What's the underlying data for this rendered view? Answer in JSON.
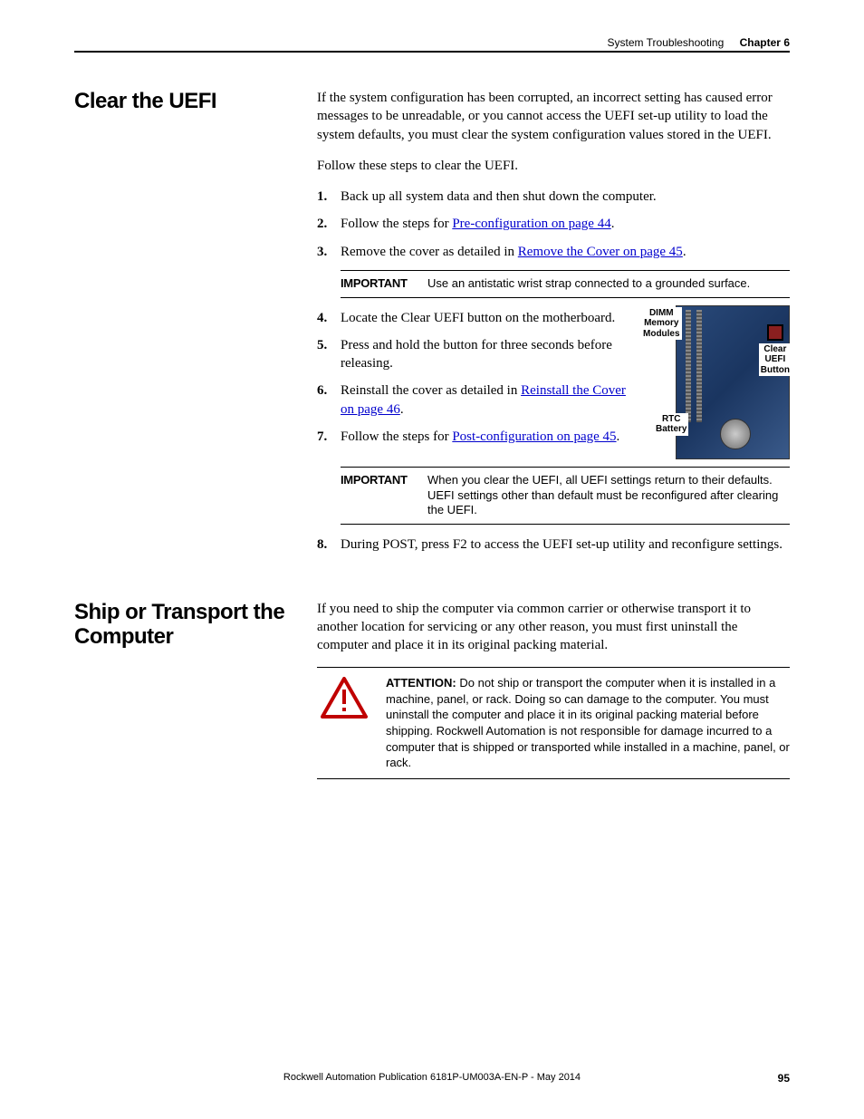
{
  "header": {
    "section": "System Troubleshooting",
    "chapter": "Chapter 6"
  },
  "sections": {
    "uefi": {
      "title": "Clear the UEFI",
      "intro": "If the system configuration has been corrupted, an incorrect setting has caused error messages to be unreadable, or you cannot access the UEFI set-up utility to load the system defaults, you must clear the system configuration values stored in the UEFI.",
      "follow": "Follow these steps to clear the UEFI.",
      "steps": {
        "s1": "Back up all system data and then shut down the computer.",
        "s2a": "Follow the steps for ",
        "s2link": "Pre-configuration on page 44",
        "s2b": ".",
        "s3a": "Remove the cover as detailed in ",
        "s3link": "Remove the Cover on page 45",
        "s3b": ".",
        "s4": "Locate the Clear UEFI button on the motherboard.",
        "s5": "Press and hold the button for three seconds before releasing.",
        "s6a": "Reinstall the cover as detailed in ",
        "s6link": "Reinstall the Cover on page 46",
        "s6b": ".",
        "s7a": "Follow the steps for ",
        "s7link": "Post-configuration on page 45",
        "s7b": ".",
        "s8": "During POST, press F2 to access the UEFI set-up utility and reconfigure settings."
      },
      "important1": {
        "label": "IMPORTANT",
        "text": "Use an antistatic wrist strap connected to a grounded surface."
      },
      "important2": {
        "label": "IMPORTANT",
        "text": "When you clear the UEFI, all UEFI settings return to their defaults. UEFI settings other than default must be reconfigured after clearing the UEFI."
      },
      "figure_labels": {
        "dimm": "DIMM\nMemory\nModules",
        "clear": "Clear\nUEFI\nButton",
        "rtc": "RTC\nBattery"
      }
    },
    "ship": {
      "title": "Ship or Transport the Computer",
      "intro": "If you need to ship the computer via common carrier or otherwise transport it to another location for servicing or any other reason, you must first uninstall the computer and place it in its original packing material.",
      "attention": {
        "label": "ATTENTION:",
        "text": " Do not ship or transport the computer when it is installed in a machine, panel, or rack. Doing so can damage to the computer. You must uninstall the computer and place it in its original packing material before shipping. Rockwell Automation is not responsible for damage incurred to a computer that is shipped or transported while installed in a machine, panel, or rack."
      }
    }
  },
  "footer": {
    "pub": "Rockwell Automation Publication 6181P-UM003A-EN-P - May 2014",
    "page": "95"
  }
}
